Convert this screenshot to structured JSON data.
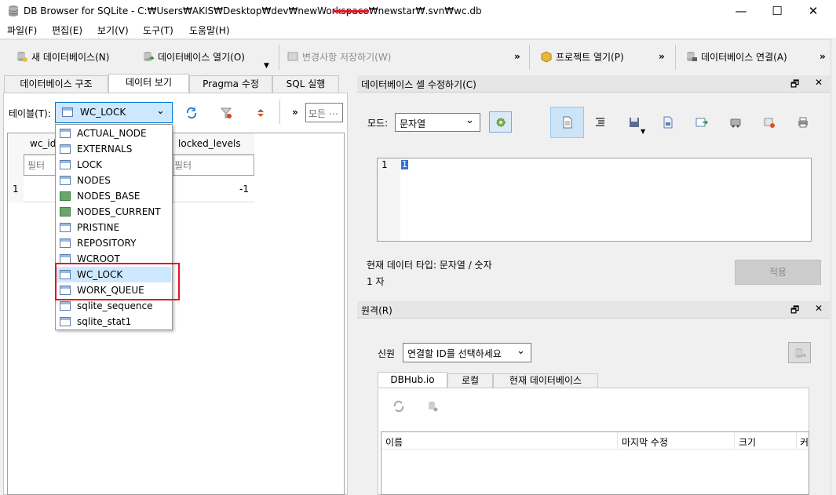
{
  "window": {
    "title": "DB Browser for SQLite - C:₩Users₩AKIS₩Desktop₩dev₩newWorkspace₩newstar₩.svn₩wc.db",
    "minimize": "—",
    "maximize": "☐",
    "close": "✕"
  },
  "menu": [
    "파일(F)",
    "편집(E)",
    "보기(V)",
    "도구(T)",
    "도움말(H)"
  ],
  "toolbar": {
    "new_db": "새 데이터베이스(N)",
    "open_db": "데이터베이스 열기(O)",
    "write_changes": "변경사항 저장하기(W)",
    "open_project": "프로젝트 열기(P)",
    "attach_db": "데이터베이스 연결(A)",
    "more": "»"
  },
  "left_tabs": [
    "데이터베이스 구조",
    "데이터 보기",
    "Pragma 수정",
    "SQL 실행"
  ],
  "browse": {
    "table_label": "테이블(T):",
    "selected_table": "WC_LOCK",
    "filter_all_placeholder": "모든 ⋯",
    "more": "»",
    "columns": [
      "wc_id",
      "locked_levels"
    ],
    "filter_placeholder": "필터",
    "rows": [
      {
        "num": "1",
        "locked_levels": "-1"
      }
    ]
  },
  "dropdown_items": [
    {
      "label": "ACTUAL_NODE",
      "kind": "table"
    },
    {
      "label": "EXTERNALS",
      "kind": "table"
    },
    {
      "label": "LOCK",
      "kind": "table"
    },
    {
      "label": "NODES",
      "kind": "table"
    },
    {
      "label": "NODES_BASE",
      "kind": "view"
    },
    {
      "label": "NODES_CURRENT",
      "kind": "view"
    },
    {
      "label": "PRISTINE",
      "kind": "table"
    },
    {
      "label": "REPOSITORY",
      "kind": "table"
    },
    {
      "label": "WCROOT",
      "kind": "table"
    },
    {
      "label": "WC_LOCK",
      "kind": "table",
      "selected": true
    },
    {
      "label": "WORK_QUEUE",
      "kind": "table"
    },
    {
      "label": "sqlite_sequence",
      "kind": "table"
    },
    {
      "label": "sqlite_stat1",
      "kind": "table"
    }
  ],
  "edit_cell": {
    "title": "데이터베이스 셀 수정하기(C)",
    "float_icon": "🗗",
    "close_icon": "✕",
    "mode_label": "모드:",
    "mode_value": "문자열",
    "line_number": "1",
    "cursor_text": "1",
    "type_info": "현재 데이터 타입: 문자열 / 숫자",
    "size_info": "1 자",
    "apply": "적용"
  },
  "remote": {
    "title": "원격(R)",
    "float_icon": "🗗",
    "close_icon": "✕",
    "identity_label": "신원",
    "identity_value": "연결할 ID를 선택하세요",
    "tabs": [
      "DBHub.io",
      "로컬",
      "현재 데이터베이스"
    ],
    "columns": [
      "이름",
      "마지막 수정",
      "크기",
      "커"
    ]
  },
  "colors": {
    "accent": "#0078d7",
    "selection": "#cde8ff",
    "highlight_box": "#e81123"
  }
}
